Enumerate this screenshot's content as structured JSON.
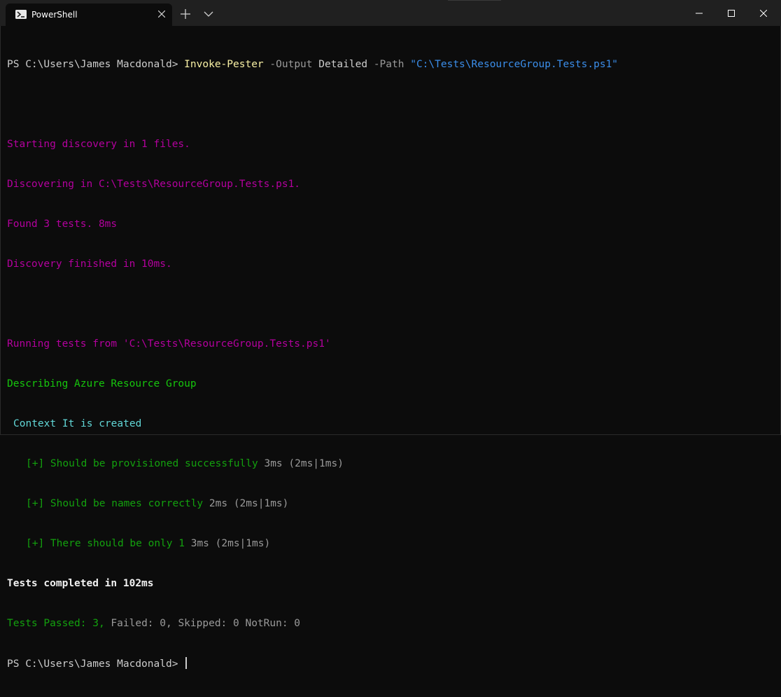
{
  "tab": {
    "title": "PowerShell",
    "icon": "powershell-icon"
  },
  "caption_buttons": [
    "minimize-icon",
    "maximize-icon",
    "close-icon"
  ],
  "colors": {
    "background": "#0c0c0c",
    "titlebar": "#202020",
    "magenta": "#b4009e",
    "green": "#16c60c",
    "cyan": "#61d6d6",
    "yellow": "#f9f1a5",
    "blue": "#3b8eea"
  },
  "terminal": {
    "command": {
      "prompt": "PS C:\\Users\\James Macdonald> ",
      "cmdlet": "Invoke-Pester",
      "param1": " -Output",
      "value1": " Detailed",
      "param2": " -Path",
      "value2": " \"C:\\Tests\\ResourceGroup.Tests.ps1\""
    },
    "discovery": [
      "Starting discovery in 1 files.",
      "Discovering in C:\\Tests\\ResourceGroup.Tests.ps1.",
      "Found 3 tests. 8ms",
      "Discovery finished in 10ms."
    ],
    "running": "Running tests from 'C:\\Tests\\ResourceGroup.Tests.ps1'",
    "describe": "Describing Azure Resource Group",
    "context": "Context It is created",
    "tests": [
      {
        "label": "[+] Should be provisioned successfully",
        "timing": " 3ms (2ms|1ms)"
      },
      {
        "label": "[+] Should be names correctly",
        "timing": " 2ms (2ms|1ms)"
      },
      {
        "label": "[+] There should be only 1",
        "timing": " 3ms (2ms|1ms)"
      }
    ],
    "completed": "Tests completed in 102ms",
    "summary": {
      "passed": "Tests Passed: 3,",
      "rest": " Failed: 0, Skipped: 0 NotRun: 0"
    },
    "final_prompt": "PS C:\\Users\\James Macdonald> "
  }
}
